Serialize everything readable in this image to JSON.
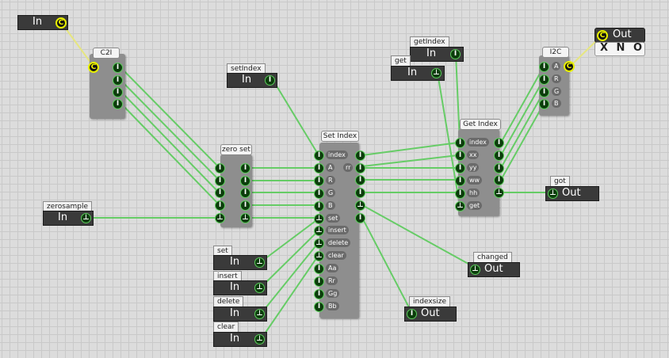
{
  "colors": {
    "wire": "#66cc66",
    "clock_wire": "#e6e680",
    "port_ring": "#5bcc5b",
    "clock_ring": "#e8f000"
  },
  "nodes": {
    "c2i": {
      "title": "C2I"
    },
    "i2c": {
      "title": "I2C",
      "pins": [
        "A",
        "R",
        "G",
        "B"
      ]
    },
    "zero_set": {
      "title": "zero set"
    },
    "set_index": {
      "title": "Set Index",
      "inputs": [
        "index",
        "A",
        "R",
        "G",
        "B",
        "set",
        "insert",
        "delete",
        "clear",
        "Aa",
        "Rr",
        "Gg",
        "Bb"
      ],
      "extra_label": "rr"
    },
    "get_index": {
      "title": "Get Index",
      "inputs": [
        "index",
        "xx",
        "yy",
        "ww",
        "hh",
        "get"
      ]
    }
  },
  "io": {
    "in_color": {
      "label": "In"
    },
    "set_index_in": {
      "title": "setIndex",
      "label": "In"
    },
    "zerosample": {
      "title": "zerosample",
      "label": "In"
    },
    "set": {
      "title": "set",
      "label": "In"
    },
    "insert": {
      "title": "insert",
      "label": "In"
    },
    "delete": {
      "title": "delete",
      "label": "In"
    },
    "clear": {
      "title": "clear",
      "label": "In"
    },
    "getindex": {
      "title": "getIndex",
      "label": "In"
    },
    "get": {
      "title": "get",
      "label": "In"
    },
    "out_color": {
      "label": "Out",
      "xno": "X N O"
    },
    "got": {
      "title": "got",
      "label": "Out"
    },
    "changed": {
      "title": "changed",
      "label": "Out"
    },
    "indexsize": {
      "title": "indexsize",
      "label": "Out"
    }
  },
  "port_glyphs": {
    "int": "I",
    "trigger": "⊥",
    "color": "C"
  }
}
